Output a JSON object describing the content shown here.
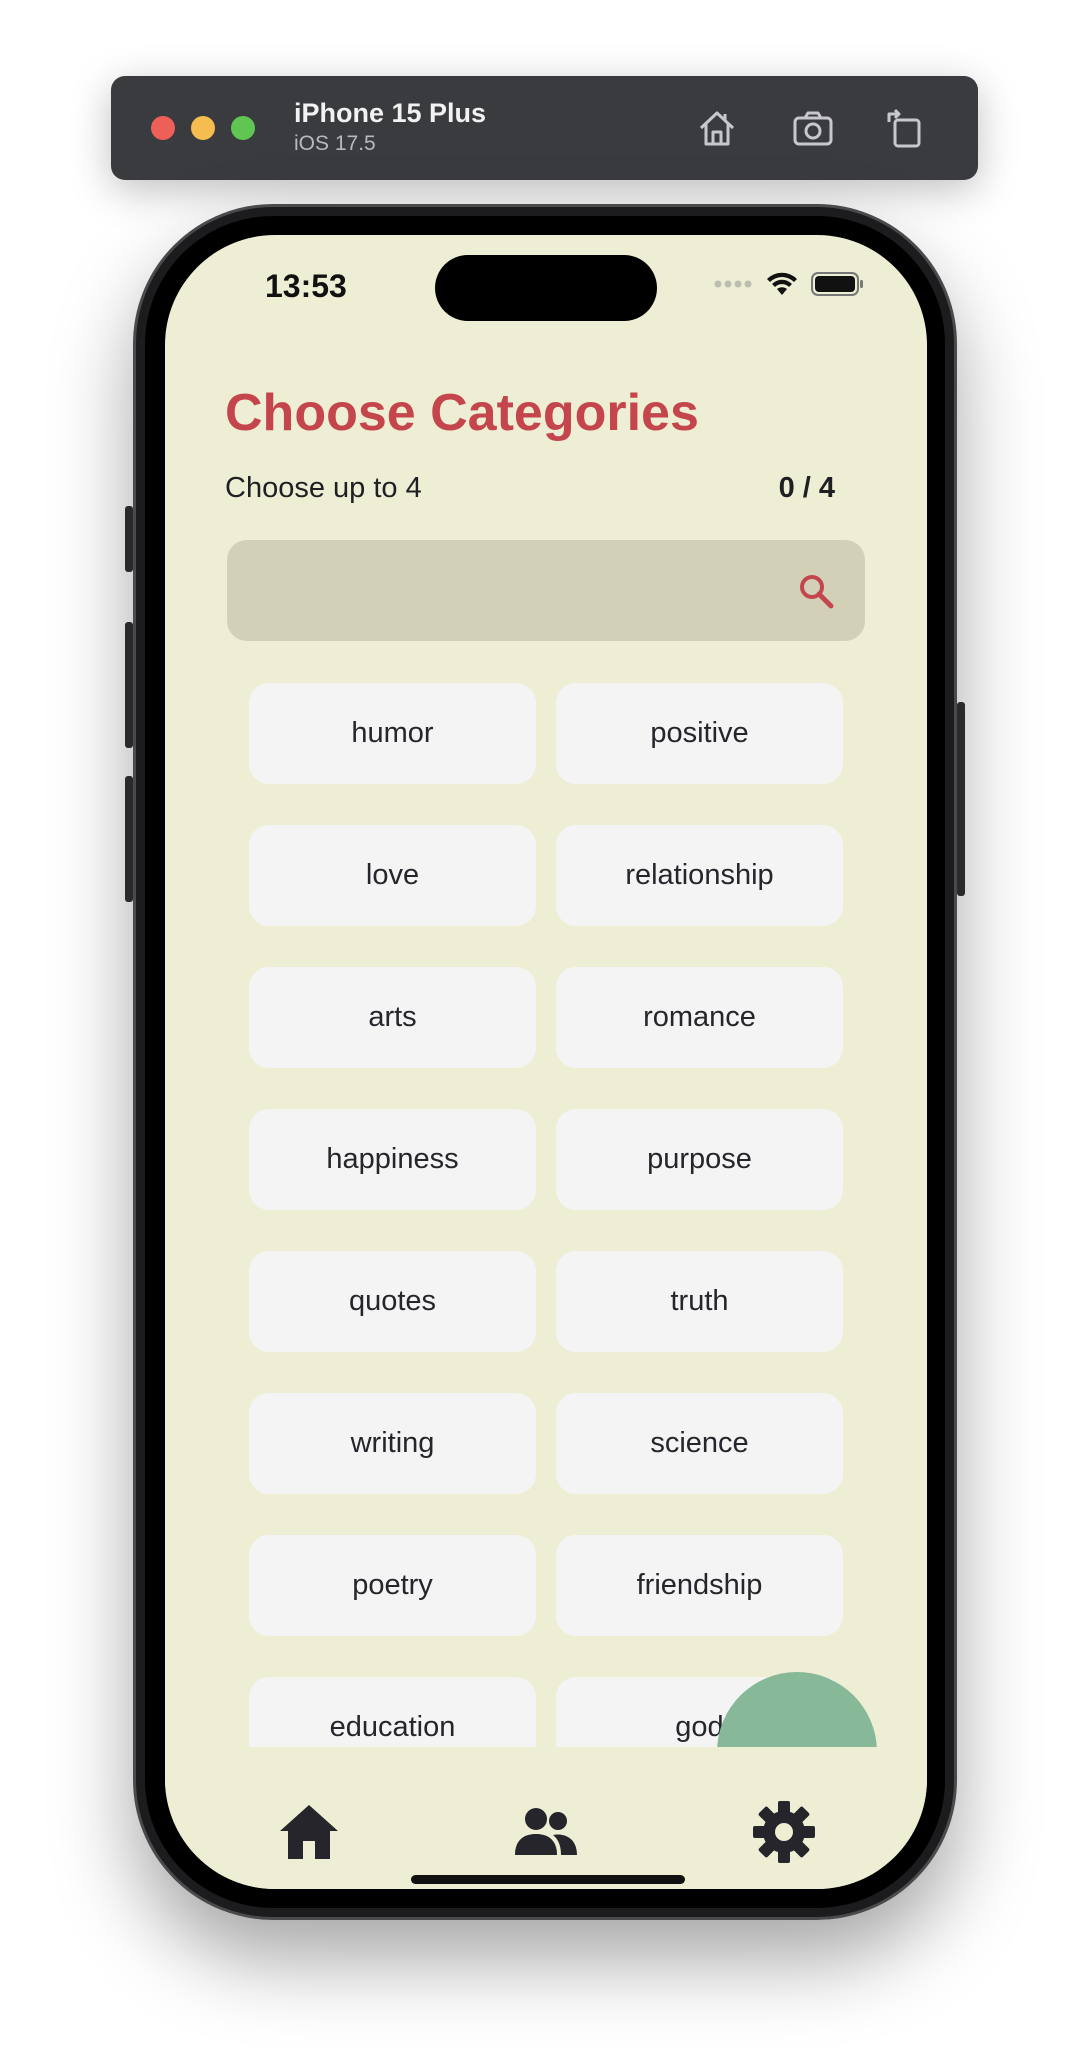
{
  "simulator": {
    "device_name": "iPhone 15 Plus",
    "os_version": "iOS 17.5",
    "icons": [
      "home-icon",
      "screenshot-icon",
      "rotate-icon"
    ]
  },
  "status_bar": {
    "time": "13:53",
    "icons": [
      "signal-icon",
      "wifi-icon",
      "battery-icon"
    ]
  },
  "page": {
    "title": "Choose Categories",
    "subtitle": "Choose up to 4",
    "counter": "0 / 4"
  },
  "search": {
    "value": "",
    "placeholder": "",
    "icon": "search-icon"
  },
  "categories": [
    "humor",
    "positive",
    "love",
    "relationship",
    "arts",
    "romance",
    "happiness",
    "purpose",
    "quotes",
    "truth",
    "writing",
    "science",
    "poetry",
    "friendship",
    "education",
    "god"
  ],
  "bottom_nav": {
    "items": [
      {
        "icon": "home-icon"
      },
      {
        "icon": "people-icon"
      },
      {
        "icon": "settings-icon"
      }
    ]
  },
  "colors": {
    "background": "#eeeed5",
    "accent": "#c4464c",
    "search_bg": "#d2d1b8",
    "chip_bg": "#f4f4f4",
    "fab": "#87b898",
    "text": "#1f1f24"
  }
}
